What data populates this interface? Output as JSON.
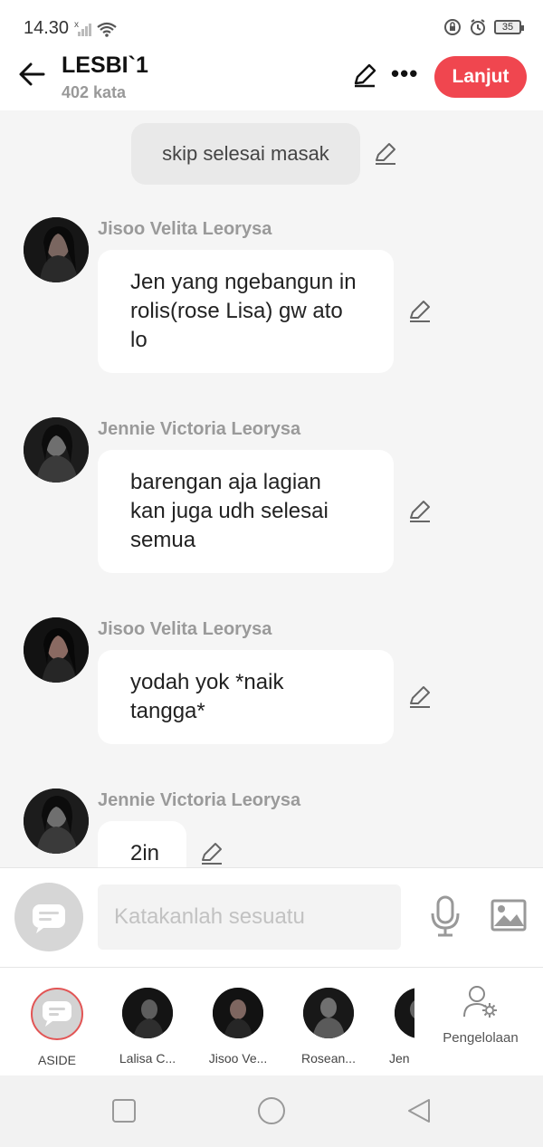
{
  "status_bar": {
    "time": "14.30",
    "battery": "35",
    "icons": [
      "signal-x-icon",
      "wifi-icon",
      "lock-rotation-icon",
      "alarm-icon",
      "battery-icon"
    ]
  },
  "header": {
    "title": "LESBI`1",
    "word_count": "402 kata",
    "next_label": "Lanjut",
    "accent_color": "#f0464f"
  },
  "chat": {
    "narration": "skip selesai masak",
    "messages": [
      {
        "sender": "Jisoo Velita Leorysa",
        "text": "Jen yang ngebangun in rolis(rose Lisa) gw ato lo"
      },
      {
        "sender": "Jennie Victoria Leorysa",
        "text": "barengan aja lagian kan juga udh selesai semua"
      },
      {
        "sender": "Jisoo Velita Leorysa",
        "text": "yodah yok *naik tangga*"
      },
      {
        "sender": "Jennie Victoria Leorysa",
        "text": "2in"
      }
    ]
  },
  "composer": {
    "placeholder": "Katakanlah sesuatu"
  },
  "characters": [
    {
      "label": "ASIDE"
    },
    {
      "label": "Lalisa C..."
    },
    {
      "label": "Jisoo Ve..."
    },
    {
      "label": "Rosean..."
    },
    {
      "label": "Jen"
    }
  ],
  "manage_label": "Pengelolaan"
}
